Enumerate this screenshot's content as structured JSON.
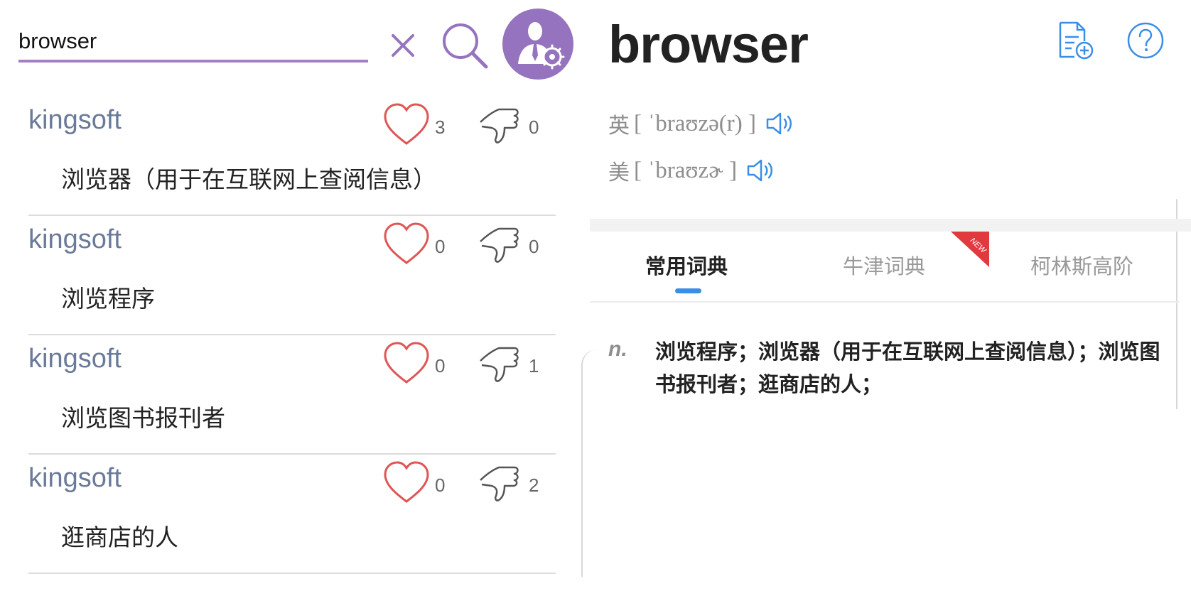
{
  "search": {
    "query": "browser"
  },
  "entries": [
    {
      "source": "kingsoft",
      "meaning": "浏览器（用于在互联网上查阅信息）",
      "likes": "3",
      "dislikes": "0"
    },
    {
      "source": "kingsoft",
      "meaning": "浏览程序",
      "likes": "0",
      "dislikes": "0"
    },
    {
      "source": "kingsoft",
      "meaning": "浏览图书报刊者",
      "likes": "0",
      "dislikes": "1"
    },
    {
      "source": "kingsoft",
      "meaning": "逛商店的人",
      "likes": "0",
      "dislikes": "2"
    }
  ],
  "word": {
    "headword": "browser",
    "uk": {
      "label": "英",
      "ipa": "[ ˈbraʊzə(r) ]"
    },
    "us": {
      "label": "美",
      "ipa": "[ ˈbraʊzɚ ]"
    }
  },
  "tabs": [
    {
      "label": "常用词典",
      "active": true
    },
    {
      "label": "牛津词典",
      "badge": "NEW"
    },
    {
      "label": "柯林斯高阶"
    }
  ],
  "definition": {
    "pos": "n.",
    "text": "浏览程序；浏览器（用于在互联网上查阅信息）；浏览图书报刊者；逛商店的人；"
  },
  "colors": {
    "accent_purple": "#9673be",
    "link_blue": "#3a8ee6",
    "heart_red": "#e05555",
    "badge_red": "#e0393e"
  },
  "icons": [
    "clear-icon",
    "search-icon",
    "account-settings-icon",
    "heart-icon",
    "thumbs-down-icon",
    "notes-add-icon",
    "help-icon",
    "speaker-icon"
  ]
}
